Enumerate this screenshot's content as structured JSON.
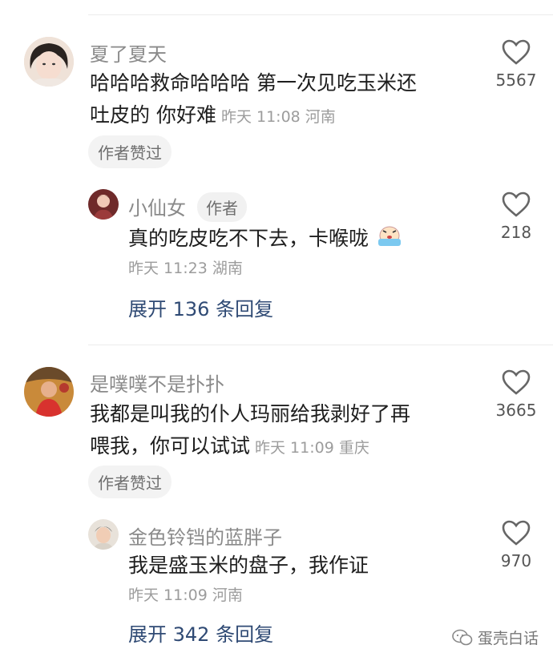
{
  "comments": [
    {
      "user": "夏了夏天",
      "text_line1": "哈哈哈救命哈哈哈 第一次见吃玉米还",
      "text_line2": "吐皮的 你好难",
      "time": "昨天 11:08",
      "location": "河南",
      "chip": "作者赞过",
      "likes": "5567",
      "reply": {
        "user": "小仙女",
        "author_tag": "作者",
        "text": "真的吃皮吃不下去，卡喉咙",
        "emoji": "crying-face-icon",
        "time": "昨天 11:23",
        "location": "湖南",
        "likes": "218"
      },
      "expand": "展开 136 条回复"
    },
    {
      "user": "是噗噗不是扑扑",
      "text_line1": "我都是叫我的仆人玛丽给我剥好了再",
      "text_line2": "喂我，你可以试试",
      "time": "昨天 11:09",
      "location": "重庆",
      "chip": "作者赞过",
      "likes": "3665",
      "reply": {
        "user": "金色铃铛的蓝胖子",
        "text": "我是盛玉米的盘子，我作证",
        "time": "昨天 11:09",
        "location": "河南",
        "likes": "970"
      },
      "expand": "展开 342 条回复"
    }
  ],
  "watermark": "蛋壳白话",
  "colors": {
    "expand": "#2f4a74",
    "meta": "#9c9c9c"
  }
}
